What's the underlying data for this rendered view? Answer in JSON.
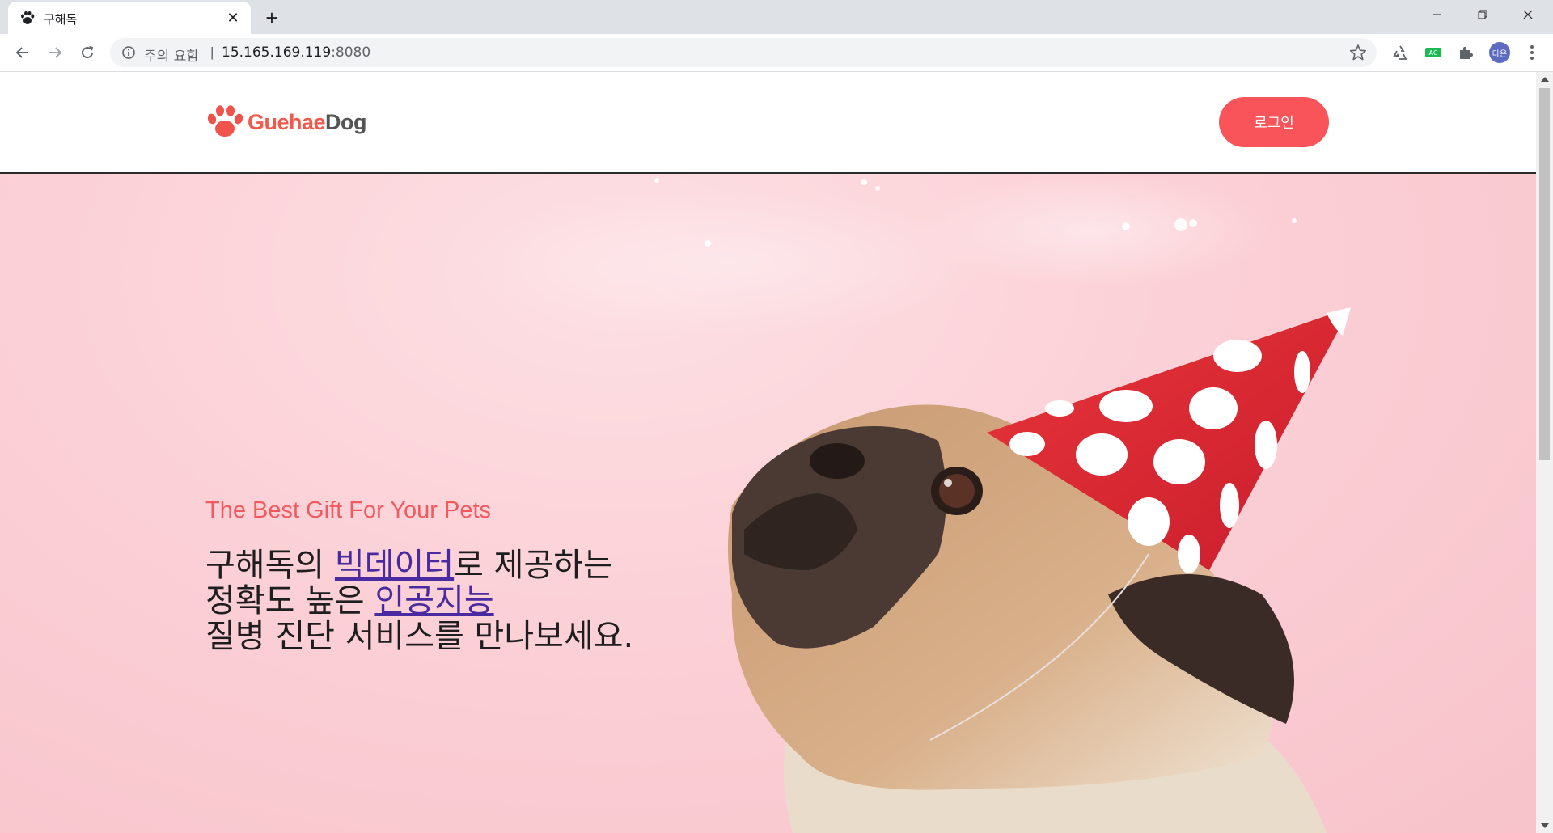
{
  "browser": {
    "tab_title": "구해독",
    "url_warning": "주의 요함",
    "url_separator": "|",
    "url_host": "15.165.169.119",
    "url_port": ":8080",
    "profile_initials": "다은",
    "extension_badge": "AC"
  },
  "site": {
    "logo_part1": "Guehae",
    "logo_part2": "Dog",
    "login_label": "로그인"
  },
  "hero": {
    "tagline": "The Best Gift For Your Pets",
    "line1_a": "구해독의 ",
    "line1_link": "빅데이터",
    "line1_b": "로 제공하는",
    "line2_a": "정확도 높은 ",
    "line2_link": "인공지능",
    "line3": "질병 진단 서비스를 만나보세요."
  },
  "colors": {
    "accent": "#f8545a",
    "hero_bg": "#fbd0d6",
    "link": "#4a2aa0"
  }
}
